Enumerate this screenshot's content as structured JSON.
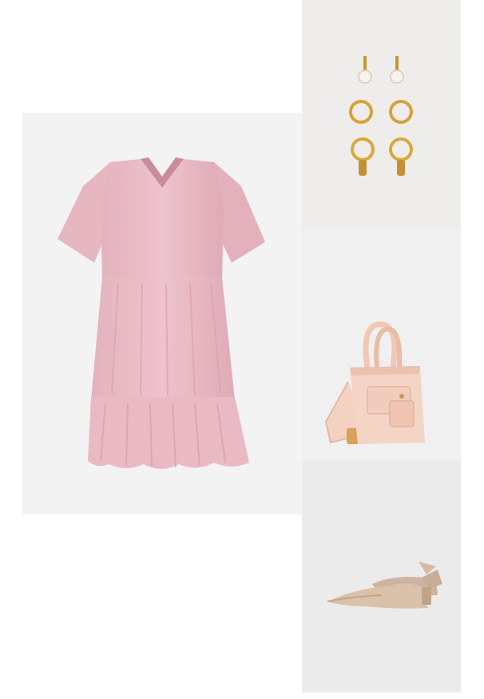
{
  "collage": {
    "items": [
      {
        "id": "dress",
        "label": "",
        "color": "#e6b8c2"
      },
      {
        "id": "earrings",
        "label": "",
        "color": "#d9a83a"
      },
      {
        "id": "handbag",
        "label": "",
        "color": "#f1d1bf"
      },
      {
        "id": "flats",
        "label": "",
        "color": "#d7bfa8"
      }
    ]
  }
}
